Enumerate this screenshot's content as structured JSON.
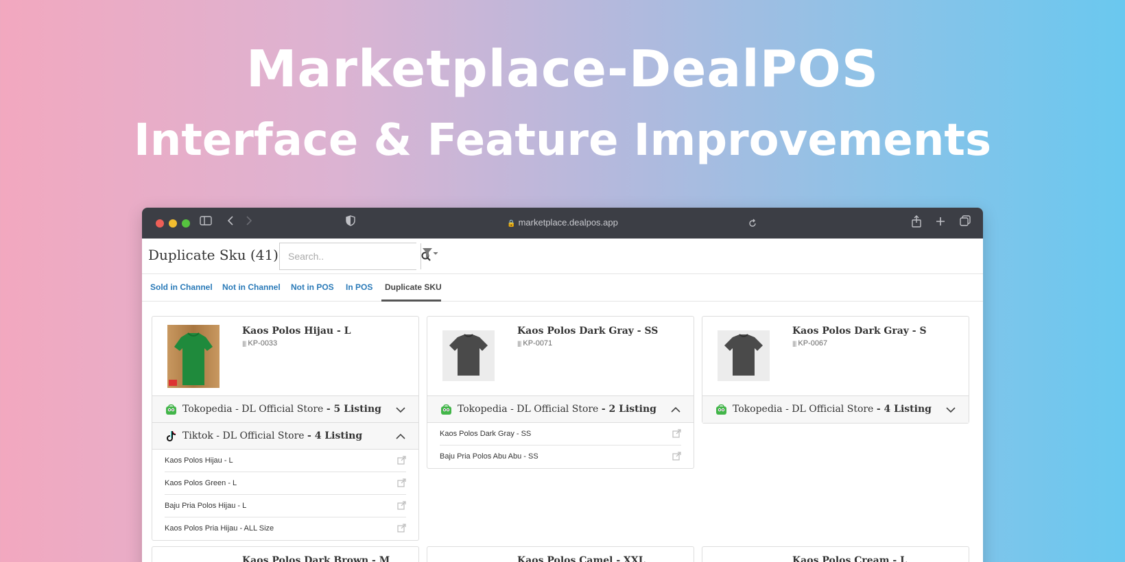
{
  "hero": {
    "line1": "Marketplace-DealPOS",
    "line2": "Interface & Feature Improvements"
  },
  "browser": {
    "url": "marketplace.dealpos.app"
  },
  "page": {
    "title": "Duplicate Sku (41)",
    "search_placeholder": "Search.."
  },
  "tabs": [
    {
      "label": "Sold in Channel"
    },
    {
      "label": "Not in Channel"
    },
    {
      "label": "Not in POS"
    },
    {
      "label": "In POS"
    },
    {
      "label": "Duplicate SKU",
      "active": true
    }
  ],
  "cards": [
    {
      "name": "Kaos Polos Hijau - L",
      "sku": "KP-0033",
      "thumb_color": "#1f8a3c",
      "channels": [
        {
          "store": "Tokopedia - DL Official Store",
          "count": "- 5 Listing",
          "expanded": false,
          "icon": "tokopedia-icon"
        },
        {
          "store": "Tiktok - DL Official Store",
          "count": "- 4 Listing",
          "expanded": true,
          "icon": "tiktok-icon",
          "listings": [
            "Kaos Polos Hijau - L",
            "Kaos Polos Green - L",
            "Baju Pria Polos Hijau - L",
            "Kaos Polos Pria Hijau - ALL Size"
          ]
        }
      ]
    },
    {
      "name": "Kaos Polos Dark Gray - SS",
      "sku": "KP-0071",
      "thumb_color": "#4a4a4a",
      "channels": [
        {
          "store": "Tokopedia - DL Official Store",
          "count": "- 2 Listing",
          "expanded": true,
          "icon": "tokopedia-icon",
          "listings": [
            "Kaos Polos Dark Gray - SS",
            "Baju Pria Polos Abu Abu - SS"
          ]
        }
      ]
    },
    {
      "name": "Kaos Polos Dark Gray - S",
      "sku": "KP-0067",
      "thumb_color": "#4a4a4a",
      "channels": [
        {
          "store": "Tokopedia - DL Official Store",
          "count": "- 4 Listing",
          "expanded": false,
          "icon": "tokopedia-icon"
        }
      ]
    },
    {
      "name": "Kaos Polos Dark Brown - M"
    },
    {
      "name": "Kaos Polos Camel - XXL"
    },
    {
      "name": "Kaos Polos Cream - L"
    }
  ]
}
